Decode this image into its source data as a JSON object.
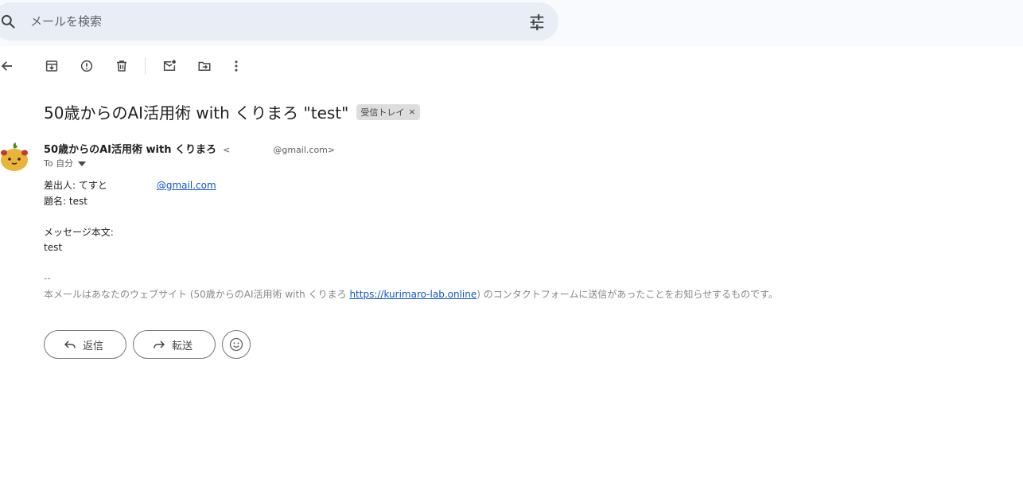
{
  "search": {
    "placeholder": "メールを検索",
    "search_icon": "search-icon",
    "filter_icon": "tune-icon"
  },
  "toolbar": {
    "icons": [
      "back-arrow-icon",
      "archive-icon",
      "report-spam-icon",
      "delete-icon",
      "mark-unread-icon",
      "move-to-icon",
      "more-vert-icon"
    ]
  },
  "message": {
    "subject": "50歳からのAI活用術 with くりまろ \"test\"",
    "label": "受信トレイ",
    "label_close": "×",
    "sender_name": "50歳からのAI活用術 with くりまろ",
    "sender_email_prefix": "<",
    "sender_email_suffix": "@gmail.com>",
    "to_text": "To 自分",
    "body": {
      "from_label": "差出人: てすと",
      "from_email": "@gmail.com",
      "subject_line": "題名: test",
      "body_label": "メッセージ本文:",
      "body_value": "test",
      "separator": "--",
      "footer_prefix": "本メールはあなたのウェブサイト (50歳からのAI活用術 with くりまろ",
      "footer_link": "https://kurimaro-lab.online",
      "footer_suffix": ") のコンタクトフォームに送信があったことをお知らせするものです。"
    }
  },
  "actions": {
    "reply": "返信",
    "forward": "転送",
    "emoji_icon": "emoji-icon"
  },
  "colors": {
    "search_bg": "#e9eef6",
    "link": "#1155cc",
    "label_chip": "#dddddd"
  }
}
